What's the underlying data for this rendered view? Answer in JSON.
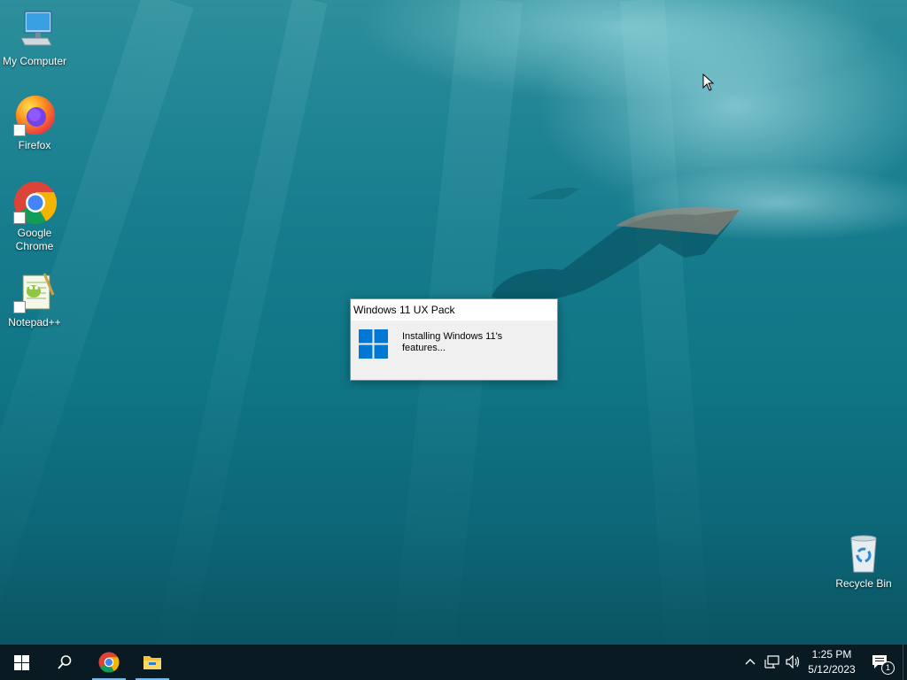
{
  "desktop_icons": [
    {
      "label": "My Computer",
      "icon": "computer-icon"
    },
    {
      "label": "Firefox",
      "icon": "firefox-icon"
    },
    {
      "label": "Google Chrome",
      "icon": "chrome-icon"
    },
    {
      "label": "Notepad++",
      "icon": "notepadpp-icon"
    },
    {
      "label": "Recycle Bin",
      "icon": "recycle-bin-icon"
    }
  ],
  "dialog": {
    "title": "Windows 11 UX Pack",
    "message": "Installing Windows 11's features...",
    "icon": "windows-logo-icon"
  },
  "taskbar": {
    "start_icon": "windows-start-icon",
    "search_icon": "search-icon",
    "pinned": [
      {
        "name": "Google Chrome",
        "icon": "chrome-icon"
      },
      {
        "name": "File Explorer",
        "icon": "folder-icon"
      }
    ],
    "tray": {
      "time": "1:25 PM",
      "date": "5/12/2023",
      "notification_count": "1"
    }
  },
  "colors": {
    "accent": "#0078d4",
    "taskbar": "#0a1a22",
    "active_indicator": "#76b9ed"
  }
}
